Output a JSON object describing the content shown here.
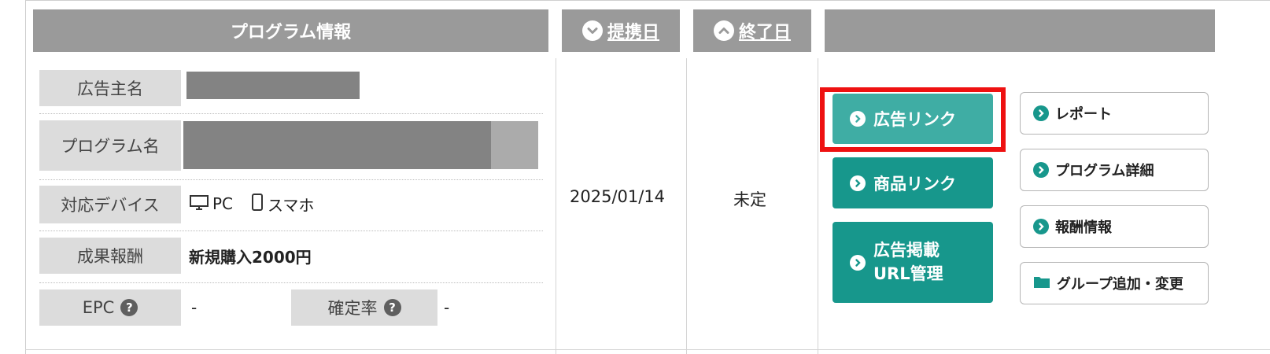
{
  "header": {
    "program_info": "プログラム情報",
    "partner_date": "提携日",
    "end_date": "終了日"
  },
  "program": {
    "advertiser_label": "広告主名",
    "program_name_label": "プログラム名",
    "devices_label": "対応デバイス",
    "devices": {
      "pc": "PC",
      "smartphone": "スマホ"
    },
    "reward_label": "成果報酬",
    "reward_value": "新規購入2000円",
    "epc_label": "EPC",
    "epc_value": "-",
    "confirm_rate_label": "確定率",
    "confirm_rate_value": "-",
    "help_glyph": "?"
  },
  "row": {
    "partner_date": "2025/01/14",
    "end_date": "未定"
  },
  "actions": {
    "ad_link": "広告リンク",
    "product_link": "商品リンク",
    "url_manage_line1": "広告掲載",
    "url_manage_line2": "URL管理",
    "report": "レポート",
    "program_detail": "プログラム詳細",
    "reward_info": "報酬情報",
    "group_edit": "グループ追加・変更"
  },
  "colors": {
    "header_bg": "#9a9a9a",
    "label_bg": "#dcdcdc",
    "teal": "#17978c",
    "teal_highlighted": "#3fada4",
    "highlight_border": "#ee1111",
    "masked": "#838383"
  },
  "icons": [
    "chevron-down-icon",
    "chevron-up-icon",
    "monitor-icon",
    "smartphone-icon",
    "help-icon",
    "chevron-right-icon",
    "folder-icon"
  ]
}
